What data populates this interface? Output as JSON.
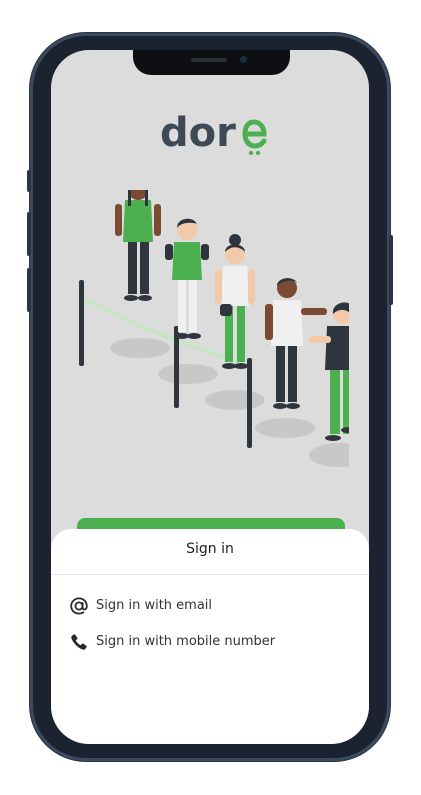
{
  "app": {
    "logo_text": "dor",
    "logo_alt": "dorè"
  },
  "sheet": {
    "title": "Sign in",
    "options": [
      {
        "label": "Sign in with email",
        "icon": "at-sign-icon"
      },
      {
        "label": "Sign in with mobile number",
        "icon": "phone-icon"
      }
    ]
  },
  "colors": {
    "brand_green": "#4caf50",
    "logo_grey": "#3d4a55",
    "screen_bg": "#dcdcdc"
  }
}
